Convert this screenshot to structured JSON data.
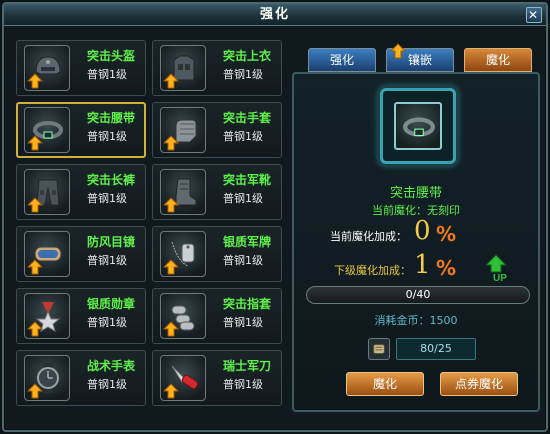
{
  "window": {
    "title": "强化"
  },
  "items": [
    {
      "name": "突击头盔",
      "level": "普钢1级",
      "icon": "helmet-icon"
    },
    {
      "name": "突击上衣",
      "level": "普钢1级",
      "icon": "armor-vest-icon"
    },
    {
      "name": "突击腰带",
      "level": "普钢1级",
      "icon": "belt-icon",
      "selected": true
    },
    {
      "name": "突击手套",
      "level": "普钢1级",
      "icon": "glove-icon"
    },
    {
      "name": "突击长裤",
      "level": "普钢1级",
      "icon": "pants-icon"
    },
    {
      "name": "突击军靴",
      "level": "普钢1级",
      "icon": "boot-icon"
    },
    {
      "name": "防风目镜",
      "level": "普钢1级",
      "icon": "goggles-icon"
    },
    {
      "name": "银质军牌",
      "level": "普钢1级",
      "icon": "dog-tag-icon"
    },
    {
      "name": "银质勋章",
      "level": "普钢1级",
      "icon": "medal-icon"
    },
    {
      "name": "突击指套",
      "level": "普钢1级",
      "icon": "finger-guard-icon"
    },
    {
      "name": "战术手表",
      "level": "普钢1级",
      "icon": "watch-icon"
    },
    {
      "name": "瑞士军刀",
      "level": "普钢1级",
      "icon": "knife-icon"
    }
  ],
  "tabs": [
    {
      "label": "强化"
    },
    {
      "label": "镶嵌"
    },
    {
      "label": "魔化"
    }
  ],
  "detail": {
    "item_name": "突击腰带",
    "status": "当前魔化：无刻印",
    "current_label": "当前魔化加成：",
    "current_value": "0",
    "current_unit": "%",
    "next_label": "下级魔化加成：",
    "next_value": "1",
    "next_unit": "%",
    "progress_text": "0/40",
    "progress_fraction": 0,
    "cost": "消耗金币：1500",
    "scroll_count": "80/25",
    "btn_enchant": "魔化",
    "btn_coupon_enchant": "点券魔化"
  },
  "colors": {
    "accent_green": "#5ef14a",
    "accent_orange": "#f07a1e",
    "gold": "#d2b23a",
    "teal": "#3aa3b3"
  }
}
